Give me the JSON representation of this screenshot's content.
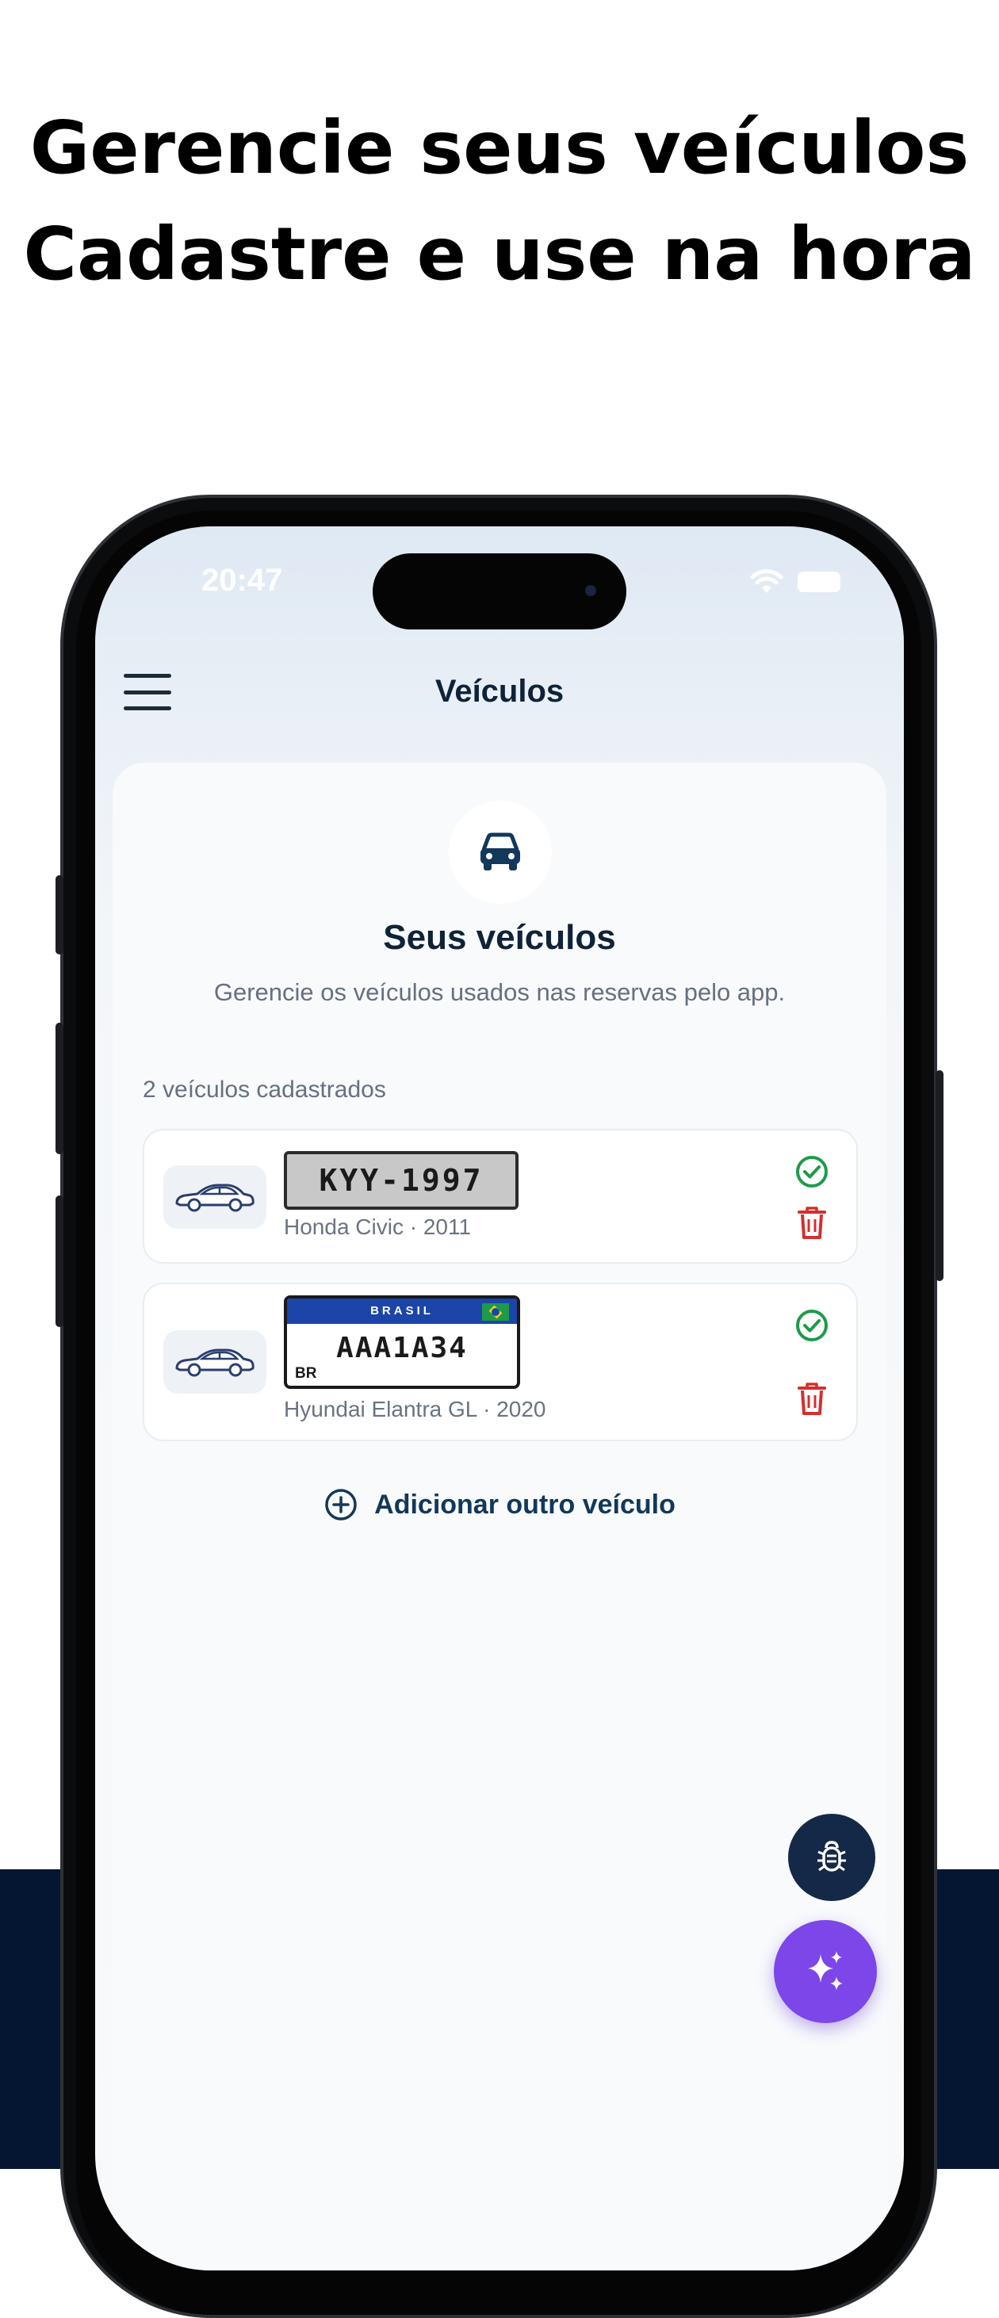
{
  "promo": {
    "line1": "Gerencie seus veículos",
    "line2": "Cadastre e use na hora"
  },
  "status_bar": {
    "time": "20:47"
  },
  "nav": {
    "title": "Veículos",
    "menu_icon": "hamburger-menu-icon"
  },
  "card": {
    "icon": "car-front-icon",
    "title": "Seus veículos",
    "subtitle": "Gerencie os veículos usados nas reservas pelo app.",
    "count_label": "2 veículos cadastrados"
  },
  "vehicles": [
    {
      "plate": "KYY-1997",
      "plate_style": "old-gray",
      "description": "Honda Civic · 2011",
      "status_icon": "check-circle-icon",
      "delete_icon": "trash-icon"
    },
    {
      "plate": "AAA1A34",
      "plate_style": "mercosul",
      "plate_header": "BRASIL",
      "plate_country": "BR",
      "description": "Hyundai Elantra GL · 2020",
      "status_icon": "check-circle-icon",
      "delete_icon": "trash-icon"
    }
  ],
  "add_vehicle": {
    "label": "Adicionar outro veículo",
    "icon": "plus-circle-icon"
  },
  "fabs": {
    "debug_icon": "bug-icon",
    "ai_icon": "sparkles-icon"
  },
  "colors": {
    "primary_navy": "#12385a",
    "success_green": "#1e9a4a",
    "danger_red": "#d32f2f",
    "fab_purple": "#7c46e8",
    "background_navy": "#041631"
  }
}
